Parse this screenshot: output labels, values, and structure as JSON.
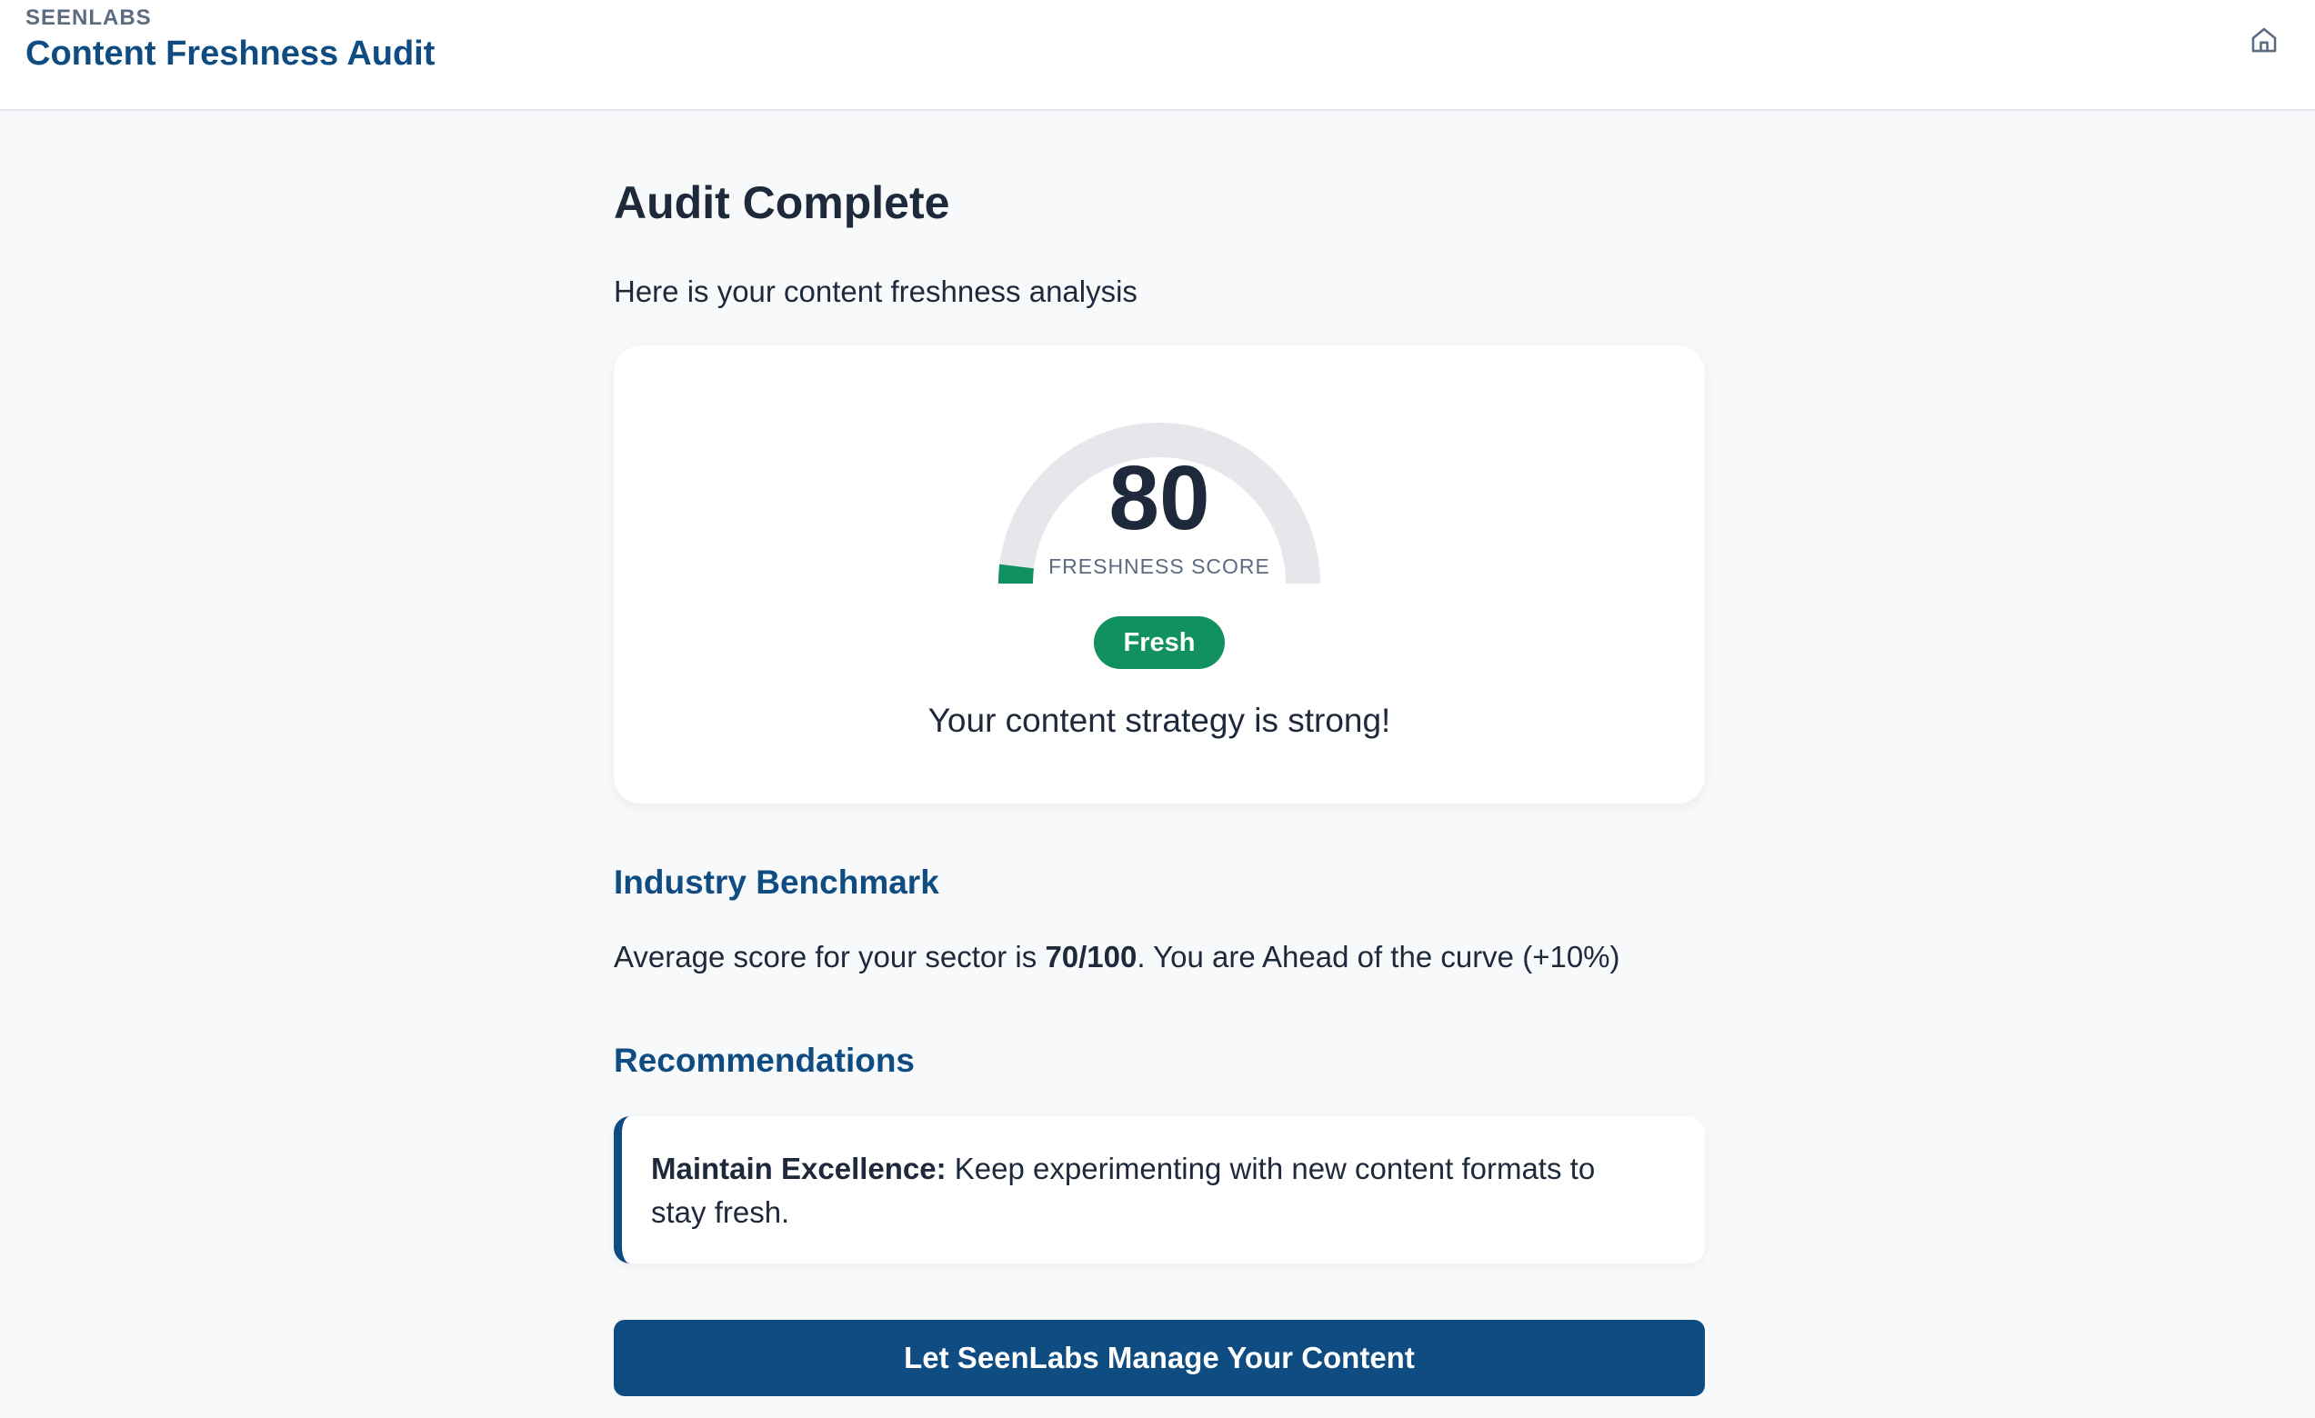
{
  "header": {
    "brand": "SEENLABS",
    "title": "Content Freshness Audit",
    "home_icon": "home-icon"
  },
  "main": {
    "title": "Audit Complete",
    "subtitle": "Here is your content freshness analysis"
  },
  "score": {
    "value": "80",
    "max": 100,
    "label": "FRESHNESS SCORE",
    "status": "Fresh",
    "message": "Your content strategy is strong!",
    "gauge_track_color": "#e5e7eb",
    "gauge_fill_color": "#10915f"
  },
  "benchmark": {
    "heading": "Industry Benchmark",
    "prefix": "Average score for your sector is ",
    "average": "70/100",
    "suffix": ". You are Ahead of the curve (+10%)"
  },
  "recommendations": {
    "heading": "Recommendations",
    "items": [
      {
        "title": "Maintain Excellence:",
        "text": " Keep experimenting with new content formats to stay fresh."
      }
    ]
  },
  "cta": {
    "label": "Let SeenLabs Manage Your Content"
  },
  "colors": {
    "primary": "#0f4c81",
    "success": "#10915f",
    "background": "#f8f9fb"
  }
}
